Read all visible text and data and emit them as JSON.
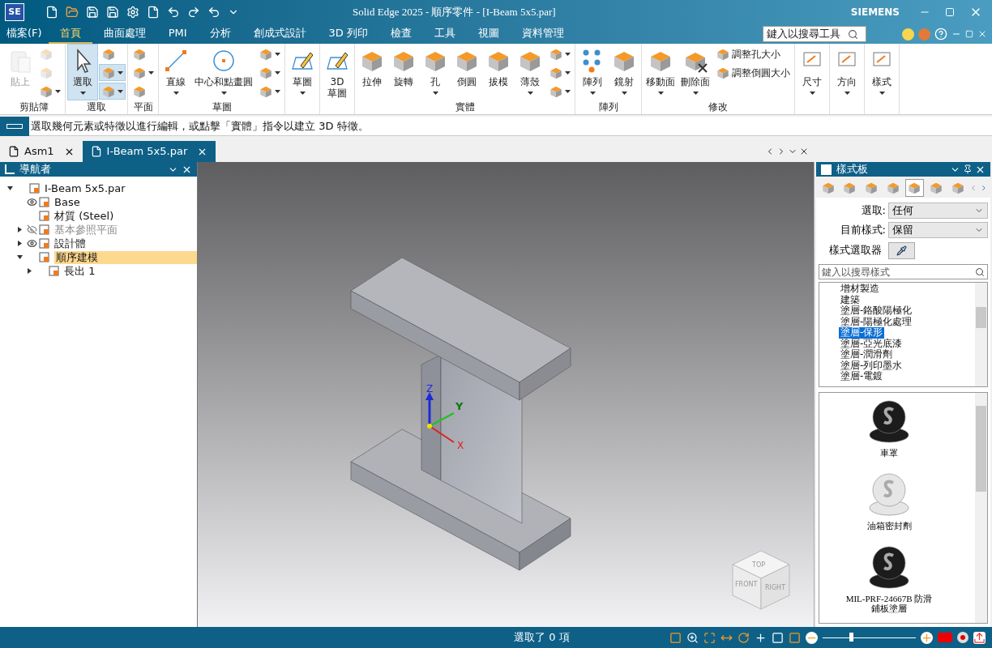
{
  "window": {
    "logo": "SE",
    "title": "Solid Edge 2025 - 順序零件 - [I-Beam 5x5.par]",
    "brand": "SIEMENS"
  },
  "menu_tabs": [
    {
      "label": "檔案(F)",
      "selected": false
    },
    {
      "label": "首頁",
      "selected": true
    },
    {
      "label": "曲面處理",
      "selected": false
    },
    {
      "label": "PMI",
      "selected": false
    },
    {
      "label": "分析",
      "selected": false
    },
    {
      "label": "創成式設計",
      "selected": false
    },
    {
      "label": "3D 列印",
      "selected": false
    },
    {
      "label": "檢查",
      "selected": false
    },
    {
      "label": "工具",
      "selected": false
    },
    {
      "label": "視圖",
      "selected": false
    },
    {
      "label": "資料管理",
      "selected": false
    }
  ],
  "tool_search": {
    "placeholder": "鍵入以搜尋工具"
  },
  "ribbon": {
    "groups": [
      {
        "label": "剪貼簿",
        "items": [
          {
            "kind": "large",
            "label": "貼上",
            "disabled": true,
            "menu": false,
            "selected": false
          },
          {
            "kind": "stack",
            "buttons": [
              {
                "disabled": true,
                "menu": false,
                "selected": false
              },
              {
                "disabled": true,
                "menu": false,
                "selected": false
              },
              {
                "disabled": false,
                "menu": true,
                "selected": false
              }
            ]
          }
        ]
      },
      {
        "label": "選取",
        "items": [
          {
            "kind": "large",
            "label": "選取",
            "disabled": false,
            "menu": true,
            "selected": true
          },
          {
            "kind": "stack",
            "buttons": [
              {
                "disabled": false,
                "menu": false,
                "selected": false
              },
              {
                "disabled": false,
                "menu": true,
                "selected": true
              },
              {
                "disabled": false,
                "menu": true,
                "selected": true
              }
            ]
          }
        ]
      },
      {
        "label": "平面",
        "items": [
          {
            "kind": "stack",
            "buttons": [
              {
                "disabled": false,
                "menu": false,
                "selected": false
              },
              {
                "disabled": false,
                "menu": true,
                "selected": false
              },
              {
                "disabled": false,
                "menu": false,
                "selected": false
              }
            ]
          }
        ]
      },
      {
        "label": "草圖",
        "items": [
          {
            "kind": "large",
            "label": "直線",
            "disabled": false,
            "menu": true,
            "selected": false
          },
          {
            "kind": "large",
            "label": "中心和點畫圓",
            "disabled": false,
            "menu": true,
            "selected": false
          },
          {
            "kind": "stack",
            "buttons": [
              {
                "disabled": false,
                "menu": true,
                "selected": false
              },
              {
                "disabled": false,
                "menu": true,
                "selected": false
              },
              {
                "disabled": false,
                "menu": true,
                "selected": false
              }
            ]
          }
        ]
      },
      {
        "items": [
          {
            "kind": "large",
            "label": "草圖",
            "disabled": false,
            "menu": true,
            "selected": false
          }
        ]
      },
      {
        "items": [
          {
            "kind": "large",
            "label": "3D 草圖",
            "disabled": false,
            "menu": false,
            "selected": false
          }
        ]
      },
      {
        "label": "實體",
        "items": [
          {
            "kind": "large",
            "label": "拉伸",
            "disabled": false,
            "menu": false,
            "selected": false
          },
          {
            "kind": "large",
            "label": "旋轉",
            "disabled": false,
            "menu": false,
            "selected": false
          },
          {
            "kind": "large",
            "label": "孔",
            "disabled": false,
            "menu": true,
            "selected": false
          },
          {
            "kind": "large",
            "label": "倒圓",
            "disabled": false,
            "menu": false,
            "selected": false
          },
          {
            "kind": "large",
            "label": "拔模",
            "disabled": false,
            "menu": false,
            "selected": false
          },
          {
            "kind": "large",
            "label": "薄殼",
            "disabled": false,
            "menu": true,
            "selected": false
          },
          {
            "kind": "stack",
            "buttons": [
              {
                "disabled": false,
                "menu": true,
                "selected": false
              },
              {
                "disabled": false,
                "menu": true,
                "selected": false
              },
              {
                "disabled": false,
                "menu": true,
                "selected": false
              }
            ]
          }
        ]
      },
      {
        "label": "陣列",
        "items": [
          {
            "kind": "large",
            "label": "陣列",
            "disabled": false,
            "menu": true,
            "selected": false
          },
          {
            "kind": "large",
            "label": "鏡射",
            "disabled": false,
            "menu": true,
            "selected": false
          }
        ]
      },
      {
        "label": "修改",
        "items": [
          {
            "kind": "large",
            "label": "移動面",
            "disabled": false,
            "menu": true,
            "selected": false
          },
          {
            "kind": "large",
            "label": "刪除面",
            "disabled": false,
            "menu": true,
            "selected": false
          },
          {
            "kind": "stack",
            "buttons": [
              {
                "label": "調整孔大小",
                "disabled": false,
                "menu": false,
                "selected": false
              },
              {
                "label": "調整倒圓大小",
                "disabled": false,
                "menu": false,
                "selected": false
              }
            ]
          }
        ]
      },
      {
        "items": [
          {
            "kind": "large",
            "label": "尺寸",
            "disabled": false,
            "menu": true,
            "selected": false
          }
        ]
      },
      {
        "items": [
          {
            "kind": "large",
            "label": "方向",
            "disabled": false,
            "menu": true,
            "selected": false
          }
        ]
      },
      {
        "items": [
          {
            "kind": "large",
            "label": "樣式",
            "disabled": false,
            "menu": true,
            "selected": false
          }
        ]
      }
    ]
  },
  "prompt": "選取幾何元素或特徵以進行編輯，或點擊「實體」指令以建立 3D 特徵。",
  "doc_tabs": [
    {
      "label": "Asm1",
      "selected": false
    },
    {
      "label": "I-Beam 5x5.par",
      "selected": true
    }
  ],
  "navigator": {
    "title": "導航者",
    "tree": [
      {
        "label": "I-Beam 5x5.par",
        "expanded": true,
        "selected": false,
        "disabled": false,
        "children": [
          {
            "label": "Base",
            "visible": true,
            "selected": false,
            "disabled": false
          },
          {
            "label": "材質 (Steel)",
            "selected": false,
            "disabled": false
          },
          {
            "label": "基本參照平面",
            "expanded": false,
            "visible": false,
            "selected": false,
            "disabled": true
          },
          {
            "label": "設計體",
            "expanded": false,
            "visible": true,
            "selected": false,
            "disabled": false
          },
          {
            "label": "順序建模",
            "expanded": true,
            "selected": true,
            "disabled": false,
            "children": [
              {
                "label": "長出 1",
                "expanded": false,
                "selected": false,
                "disabled": false
              }
            ]
          }
        ]
      }
    ]
  },
  "viewport": {
    "triad": [
      "Z",
      "Y",
      "X"
    ],
    "view_cube": [
      "TOP",
      "FRONT",
      "RIGHT"
    ]
  },
  "style_panel": {
    "title": "樣式板",
    "tab_count_selected": [
      {
        "selected": false
      },
      {
        "selected": false
      },
      {
        "selected": false
      },
      {
        "selected": false
      },
      {
        "selected": true
      },
      {
        "selected": false
      },
      {
        "selected": false
      }
    ],
    "fields": [
      {
        "label": "選取:",
        "value": "任何"
      },
      {
        "label": "目前樣式:",
        "value": "保留"
      }
    ],
    "picker_label": "樣式選取器",
    "search": {
      "placeholder": "鍵入以搜尋樣式"
    },
    "styles": [
      {
        "label": "增材製造",
        "selected": false
      },
      {
        "label": "建築",
        "selected": false
      },
      {
        "label": "塗層-鉻酸陽極化",
        "selected": false
      },
      {
        "label": "塗層-陽極化處理",
        "selected": false
      },
      {
        "label": "塗層-保形",
        "selected": true
      },
      {
        "label": "塗層-亞光底漆",
        "selected": false
      },
      {
        "label": "塗層-潤滑劑",
        "selected": false
      },
      {
        "label": "塗層-列印墨水",
        "selected": false
      },
      {
        "label": "塗層-電鍍",
        "selected": false
      }
    ],
    "previews": [
      {
        "label": "車罩",
        "color": "#1c1c1c"
      },
      {
        "label": "油箱密封劑",
        "color": "#e6e6e6"
      },
      {
        "label": "MIL-PRF-24667B 防滑鋪板塗層",
        "color": "#1c1c1c"
      }
    ]
  },
  "status_bar": {
    "text": "選取了 0 項",
    "zoom": {
      "level": 0.3
    }
  }
}
